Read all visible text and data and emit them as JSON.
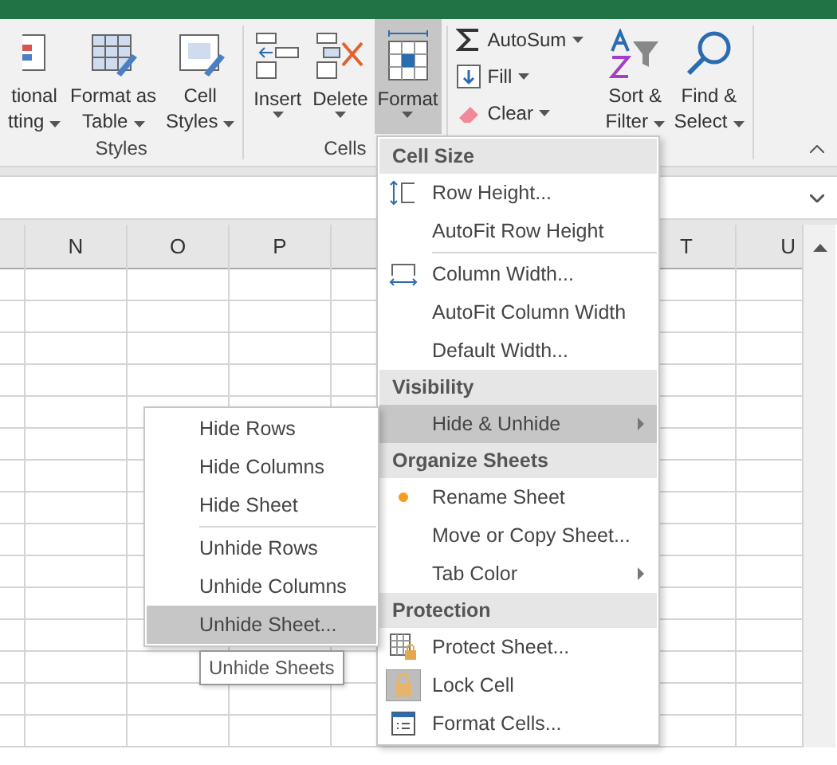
{
  "ribbon": {
    "groups": [
      {
        "label": "Styles",
        "buttons": [
          {
            "lines": [
              "tional",
              "tting"
            ],
            "pressed": false
          },
          {
            "lines": [
              "Format as",
              "Table"
            ],
            "pressed": false
          },
          {
            "lines": [
              "Cell",
              "Styles"
            ],
            "pressed": false
          }
        ]
      },
      {
        "label": "Cells",
        "buttons": [
          {
            "lines": [
              "Insert"
            ],
            "pressed": false
          },
          {
            "lines": [
              "Delete"
            ],
            "pressed": false
          },
          {
            "lines": [
              "Format"
            ],
            "pressed": true
          }
        ]
      }
    ],
    "editing": {
      "small_buttons": [
        {
          "label": "AutoSum"
        },
        {
          "label": "Fill"
        },
        {
          "label": "Clear"
        }
      ],
      "buttons": [
        {
          "lines": [
            "Sort &",
            "Filter"
          ],
          "pressed": false
        },
        {
          "lines": [
            "Find &",
            "Select"
          ],
          "pressed": false
        }
      ]
    }
  },
  "sheet": {
    "columns_left": [
      "N",
      "O",
      "P"
    ],
    "columns_right": [
      "T",
      "U"
    ]
  },
  "format_menu": [
    {
      "kind": "header",
      "label": "Cell Size"
    },
    {
      "kind": "item",
      "label": "Row Height...",
      "selected": false
    },
    {
      "kind": "item",
      "label": "AutoFit Row Height",
      "selected": false
    },
    {
      "kind": "separator"
    },
    {
      "kind": "item",
      "label": "Column Width...",
      "selected": false
    },
    {
      "kind": "item",
      "label": "AutoFit Column Width",
      "selected": false
    },
    {
      "kind": "item",
      "label": "Default Width...",
      "selected": false
    },
    {
      "kind": "header",
      "label": "Visibility"
    },
    {
      "kind": "submenu",
      "label": "Hide & Unhide",
      "selected": true
    },
    {
      "kind": "header",
      "label": "Organize Sheets"
    },
    {
      "kind": "item",
      "label": "Rename Sheet",
      "selected": false
    },
    {
      "kind": "item",
      "label": "Move or Copy Sheet...",
      "selected": false
    },
    {
      "kind": "submenu",
      "label": "Tab Color",
      "selected": false
    },
    {
      "kind": "header",
      "label": "Protection"
    },
    {
      "kind": "item",
      "label": "Protect Sheet...",
      "selected": false
    },
    {
      "kind": "item",
      "label": "Lock Cell",
      "selected": false,
      "checked": true
    },
    {
      "kind": "item",
      "label": "Format Cells...",
      "selected": false
    }
  ],
  "hide_submenu": [
    {
      "kind": "item",
      "label": "Hide Rows",
      "selected": false
    },
    {
      "kind": "item",
      "label": "Hide Columns",
      "selected": false
    },
    {
      "kind": "item",
      "label": "Hide Sheet",
      "selected": false
    },
    {
      "kind": "separator"
    },
    {
      "kind": "item",
      "label": "Unhide Rows",
      "selected": false
    },
    {
      "kind": "item",
      "label": "Unhide Columns",
      "selected": false
    },
    {
      "kind": "item",
      "label": "Unhide Sheet...",
      "selected": true
    }
  ],
  "tooltip": "Unhide Sheets"
}
